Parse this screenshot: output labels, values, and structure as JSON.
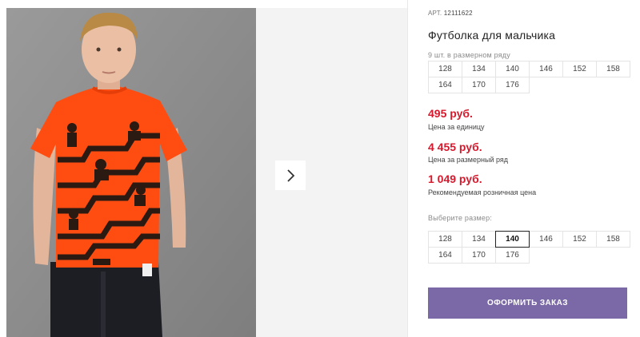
{
  "product": {
    "article_label": "АРТ.",
    "article_number": "12111622",
    "title": "Футболка для мальчика",
    "pack_caption": "9 шт. в размерном ряду",
    "pack_sizes": [
      "128",
      "134",
      "140",
      "146",
      "152",
      "158",
      "164",
      "170",
      "176"
    ]
  },
  "prices": {
    "unit_price": "495 руб.",
    "unit_label": "Цена за единицу",
    "pack_price": "4 455 руб.",
    "pack_label": "Цена за размерный ряд",
    "retail_price": "1 049 руб.",
    "retail_label": "Рекомендуемая розничная цена"
  },
  "size_picker": {
    "caption": "Выберите размер:",
    "sizes": [
      "128",
      "134",
      "140",
      "146",
      "152",
      "158",
      "164",
      "170",
      "176"
    ],
    "selected": "140"
  },
  "order": {
    "button_label": "ОФОРМИТЬ ЗАКАЗ"
  },
  "gallery": {
    "next_icon": "chevron-right-icon"
  },
  "colors": {
    "accent": "#7b68a6",
    "price": "#d6192c",
    "shirt": "#ff4d12"
  }
}
